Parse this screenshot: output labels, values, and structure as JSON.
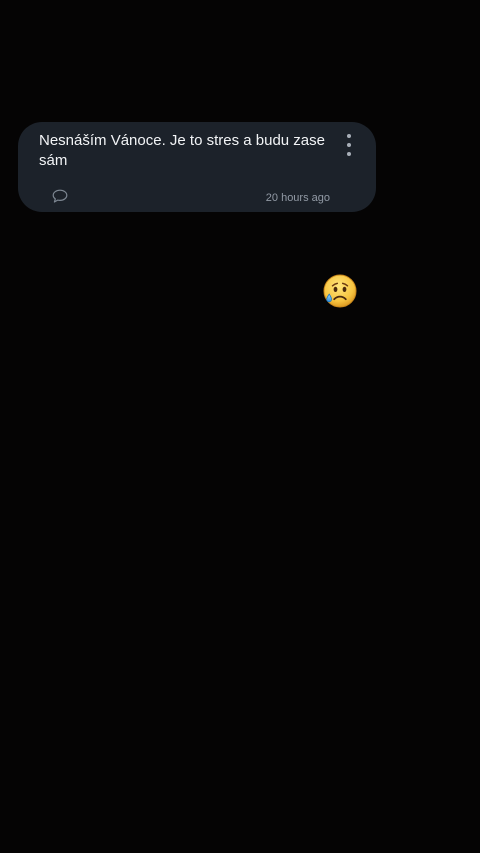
{
  "message": {
    "text": "Nesnáším Vánoce. Je to stres a budu zase sám",
    "timestamp": "20 hours ago",
    "icons": {
      "comment": "comment-bubble-icon",
      "menu": "kebab-menu-icon"
    }
  },
  "reaction": {
    "icon": "sad-crying-face-emoji"
  },
  "colors": {
    "background": "#050404",
    "card": "#1c222a",
    "text": "#f2f4f6",
    "muted": "#929aa5",
    "emoji_yellow": "#f7c440",
    "tear_blue": "#4aa8e8"
  }
}
